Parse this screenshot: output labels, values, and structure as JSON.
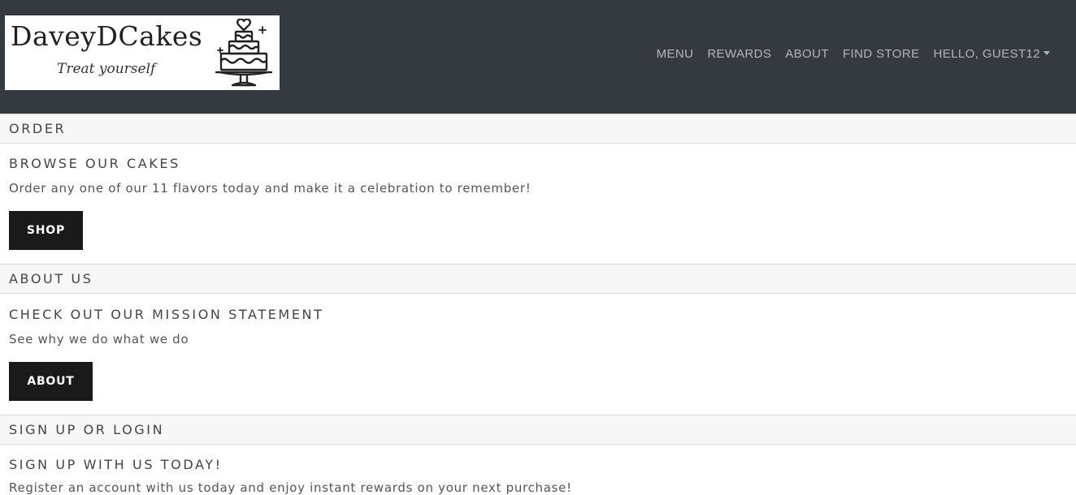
{
  "brand": {
    "name": "DaveyDCakes",
    "tagline": "Treat yourself",
    "logo_icon": "wedding-cake-icon"
  },
  "nav": {
    "items": [
      {
        "label": "MENU"
      },
      {
        "label": "REWARDS"
      },
      {
        "label": "ABOUT"
      },
      {
        "label": "FIND STORE"
      }
    ],
    "user_menu": {
      "label": "HELLO, GUEST12",
      "icon": "caret-down-icon"
    }
  },
  "sections": [
    {
      "header": "ORDER",
      "title": "BROWSE OUR CAKES",
      "text": "Order any one of our 11 flavors today and make it a celebration to remember!",
      "button": "SHOP"
    },
    {
      "header": "ABOUT US",
      "title": "CHECK OUT OUR MISSION STATEMENT",
      "text": "See why we do what we do",
      "button": "ABOUT"
    },
    {
      "header": "SIGN UP OR LOGIN",
      "title": "SIGN UP WITH US TODAY!",
      "text": "Register an account with us today and enjoy instant rewards on your next purchase!"
    }
  ],
  "colors": {
    "navbar_bg": "#343a40",
    "button_bg": "#1a1a1a",
    "section_header_bg": "#f7f7f7"
  }
}
